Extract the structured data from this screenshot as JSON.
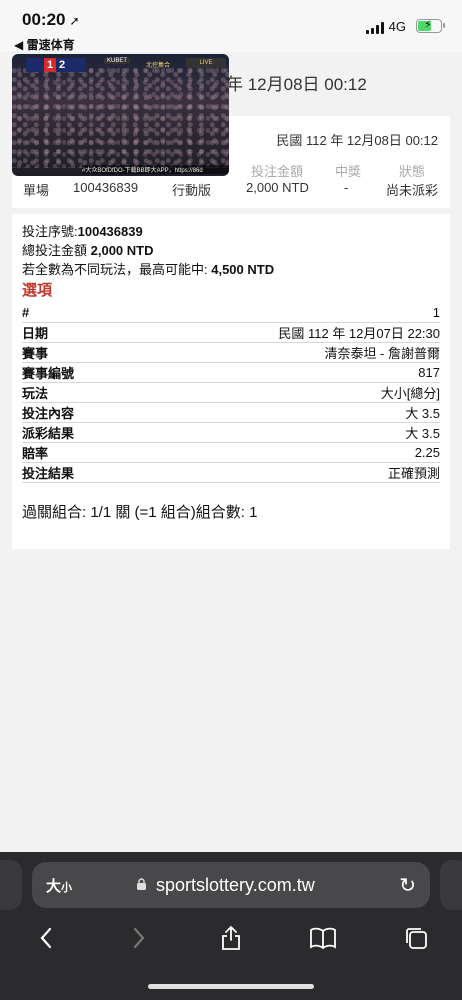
{
  "status": {
    "time": "00:20",
    "back_app": "◀ 雷速体育",
    "network": "4G"
  },
  "header": {
    "date": "年 12月08日 00:12"
  },
  "summary": {
    "date": "民國 112 年 12月08日 00:12",
    "columns": [
      {
        "head": "",
        "value": "單場"
      },
      {
        "head": "",
        "value": "100436839"
      },
      {
        "head": "",
        "value": "行動版"
      },
      {
        "head": "投注金額",
        "value": "2,000 NTD"
      },
      {
        "head": "中獎",
        "value": "-"
      },
      {
        "head": "狀態",
        "value": "尚未派彩"
      }
    ]
  },
  "detail": {
    "serial_label": "投注序號:",
    "serial_value": "100436839",
    "total_label": "總投注金額 ",
    "total_value": "2,000 NTD",
    "max_label": "若全數為不同玩法，最高可能中: ",
    "max_value": "4,500 NTD",
    "section_title": "選項",
    "rows": [
      {
        "k": "#",
        "v": "1"
      },
      {
        "k": "日期",
        "v": "民國 112 年 12月07日 22:30"
      },
      {
        "k": "賽事",
        "v": "清奈泰坦 - 詹謝普爾"
      },
      {
        "k": "賽事編號",
        "v": "817"
      },
      {
        "k": "玩法",
        "v": "大小[總分]"
      },
      {
        "k": "投注內容",
        "v": "大 3.5"
      },
      {
        "k": "派彩結果",
        "v": "大 3.5"
      },
      {
        "k": "賠率",
        "v": "2.25"
      },
      {
        "k": "投注結果",
        "v": "正確預測"
      }
    ],
    "combo": "過關組合: 1/1 關 (=1 組合)組合數: 1"
  },
  "pip": {
    "score_home": "1",
    "score_away": "2",
    "tag": "KUBET",
    "tag2": "北控集合",
    "logo": "LIVE",
    "ticker": "#大众BOfDfDO-下载BB即大APP，https://86d"
  },
  "browser": {
    "text_size": "大",
    "text_size_small": "小",
    "url": "sportslottery.com.tw"
  },
  "colors": {
    "accent_red": "#c0392b",
    "battery_green": "#4cd964"
  }
}
